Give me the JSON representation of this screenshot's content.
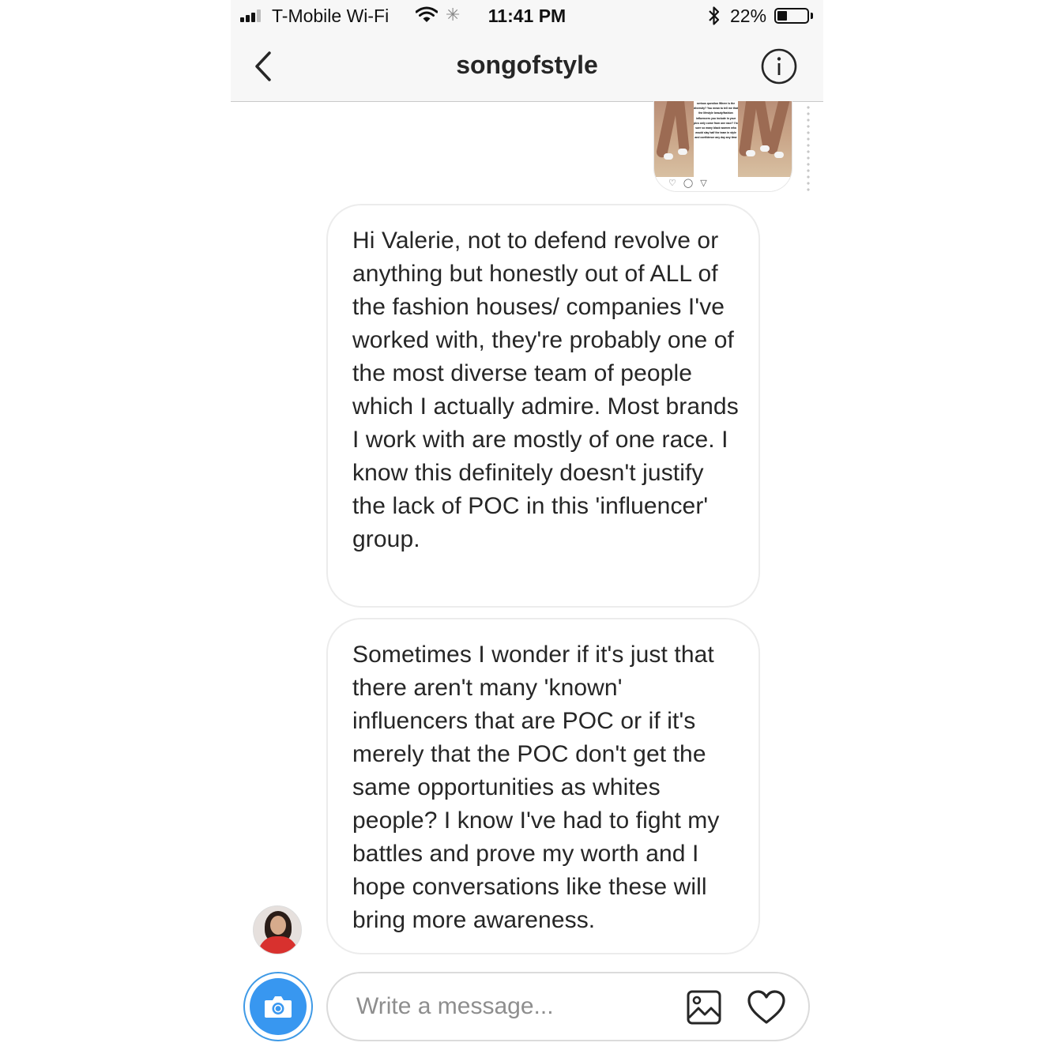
{
  "status_bar": {
    "carrier": "T-Mobile Wi-Fi",
    "time": "11:41 PM",
    "battery_percent": "22%",
    "battery_level": 0.22,
    "signal_bars": 3,
    "icons": [
      "signal-icon",
      "wifi-icon",
      "activity-spinner-icon",
      "bluetooth-icon",
      "battery-icon"
    ]
  },
  "header": {
    "title": "songofstyle",
    "back_icon": "chevron-left-icon",
    "info_icon": "info-icon"
  },
  "shared_post": {
    "caption": "serious question Where is the diversity? You mean to tell me that the lifestyle beauty/fashion influencers you include in your pics only come from one race? I'm sure so many black women who would slay half the team in style and confidence any day any time"
  },
  "messages": [
    {
      "text": "Hi Valerie, not to defend revolve or anything but honestly out of ALL of the fashion houses/ companies I've worked with, they're probably one of the most diverse team of people which I actually admire. Most brands I work with are mostly of one race. I know this definitely doesn't justify the lack of POC in this 'influencer' group."
    },
    {
      "text": "Sometimes I wonder if it's just that there aren't many 'known' influencers that are POC or if it's merely that the POC don't get the same opportunities as whites people? I know I've had to fight my battles and prove my worth and I hope conversations like these will bring more awareness."
    }
  ],
  "composer": {
    "placeholder": "Write a message...",
    "value": "",
    "camera_icon": "camera-icon",
    "gallery_icon": "gallery-icon",
    "heart_icon": "heart-icon"
  },
  "colors": {
    "accent": "#3897f0",
    "bar_background": "#f7f7f7",
    "bubble_border": "#ececec",
    "text": "#262626",
    "placeholder": "#8e8e8e"
  }
}
